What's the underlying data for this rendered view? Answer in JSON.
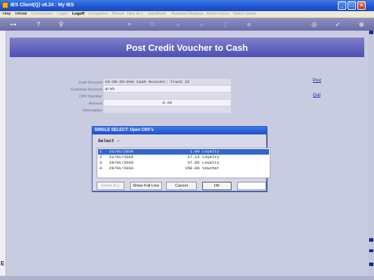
{
  "window": {
    "title": "IES Client(Q) v8.24 : My IES"
  },
  "menu": {
    "items": [
      {
        "label": "Help",
        "state": "normal"
      },
      {
        "label": "Infolab",
        "state": "normal"
      },
      {
        "label": "Connections",
        "state": "dim"
      },
      {
        "label": "Logon",
        "state": "dim"
      },
      {
        "label": "Logoff",
        "state": "bold"
      },
      {
        "label": "Companion",
        "state": "dim"
      },
      {
        "label": "Wizard",
        "state": "dim"
      },
      {
        "label": "How do I",
        "state": "dim"
      },
      {
        "label": "DataMarts",
        "state": "dim"
      },
      {
        "label": "Business Modules",
        "state": "dim"
      },
      {
        "label": "Action Focus",
        "state": "dim"
      },
      {
        "label": "Option Select",
        "state": "dim"
      }
    ]
  },
  "page": {
    "title": "Post Credit Voucher to Cash"
  },
  "form": {
    "cash_account": {
      "label": "Cash Account",
      "value": "10-00-00-84e Cash Account: Track 22"
    },
    "customer_account": {
      "label": "Customer Account",
      "value": "grab"
    },
    "crv_number": {
      "label": "CRV Number",
      "value": ""
    },
    "amount": {
      "label": "Amount",
      "value": "0.00"
    },
    "description": {
      "label": "Description",
      "value": ""
    }
  },
  "actions": {
    "post": "Post",
    "quit": "Quit"
  },
  "dialog": {
    "title": "SINGLE SELECT: Open CRV's",
    "select_label": "Select -",
    "rows": [
      {
        "num": "1",
        "date": "31/01/2010",
        "amount": "1.00",
        "desc": "Loyalty"
      },
      {
        "num": "2",
        "date": "31/01/2010",
        "amount": "17.13",
        "desc": "Loyalty"
      },
      {
        "num": "3",
        "date": "29/01/2010",
        "amount": "37.85",
        "desc": "Loyalty"
      },
      {
        "num": "4",
        "date": "29/01/2010",
        "amount": "150.00",
        "desc": "Voucher"
      }
    ],
    "selected_row": 0,
    "buttons": {
      "select_all": "Select ALL",
      "show_full_line": "Show Full Line",
      "cancel": "Cancel",
      "ok": "OK"
    }
  },
  "icons": {
    "app": "ies-app-icon",
    "toolbar": [
      "key-icon",
      "help-icon",
      "search-icon",
      "heart-icon",
      "refresh-icon",
      "rewind-icon",
      "fast-forward-icon",
      "trash-icon",
      "stop-icon",
      "globe-icon",
      "check-icon",
      "close-icon"
    ]
  },
  "colors": {
    "accent": "#4d4fb0",
    "selection": "#3168c5",
    "title_bar": "#1f56d1",
    "link": "#1a2ba0"
  }
}
